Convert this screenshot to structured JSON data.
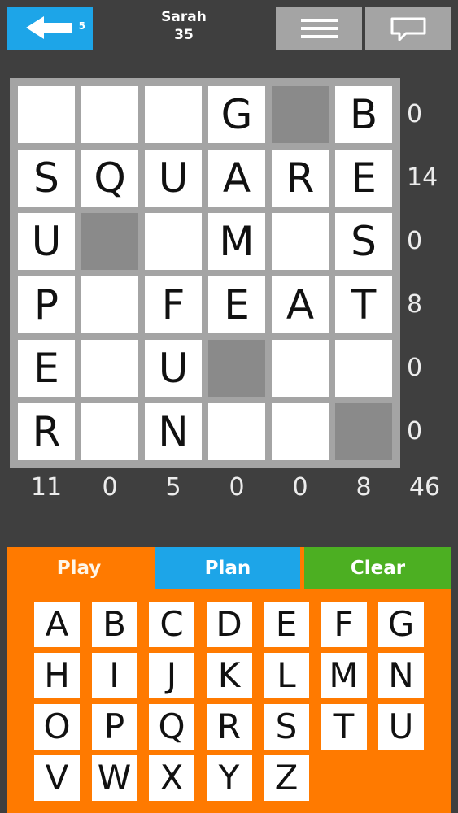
{
  "header": {
    "back_count": "5",
    "player_name": "Sarah",
    "player_score": "35"
  },
  "board": {
    "rows": [
      [
        "",
        "",
        "",
        "G",
        null,
        "B"
      ],
      [
        "S",
        "Q",
        "U",
        "A",
        "R",
        "E"
      ],
      [
        "U",
        null,
        "",
        "M",
        "",
        "S"
      ],
      [
        "P",
        "",
        "F",
        "E",
        "A",
        "T"
      ],
      [
        "E",
        "",
        "U",
        null,
        "",
        ""
      ],
      [
        "R",
        "",
        "N",
        "",
        "",
        null
      ]
    ],
    "row_scores": [
      "0",
      "14",
      "0",
      "8",
      "0",
      "0"
    ],
    "col_scores": [
      "11",
      "0",
      "5",
      "0",
      "0",
      "8"
    ],
    "total": "46"
  },
  "tabs": {
    "play": "Play",
    "plan": "Plan",
    "clear": "Clear"
  },
  "keyboard": {
    "rows": [
      [
        "A",
        "B",
        "C",
        "D",
        "E",
        "F",
        "G"
      ],
      [
        "H",
        "I",
        "J",
        "K",
        "L",
        "M",
        "N"
      ],
      [
        "O",
        "P",
        "Q",
        "R",
        "S",
        "T",
        "U"
      ],
      [
        "V",
        "W",
        "X",
        "Y",
        "Z"
      ]
    ]
  },
  "colors": {
    "accent_blue": "#1da5e8",
    "accent_orange": "#ff7a00",
    "accent_green": "#4caf22",
    "background": "#3f3f3f"
  }
}
